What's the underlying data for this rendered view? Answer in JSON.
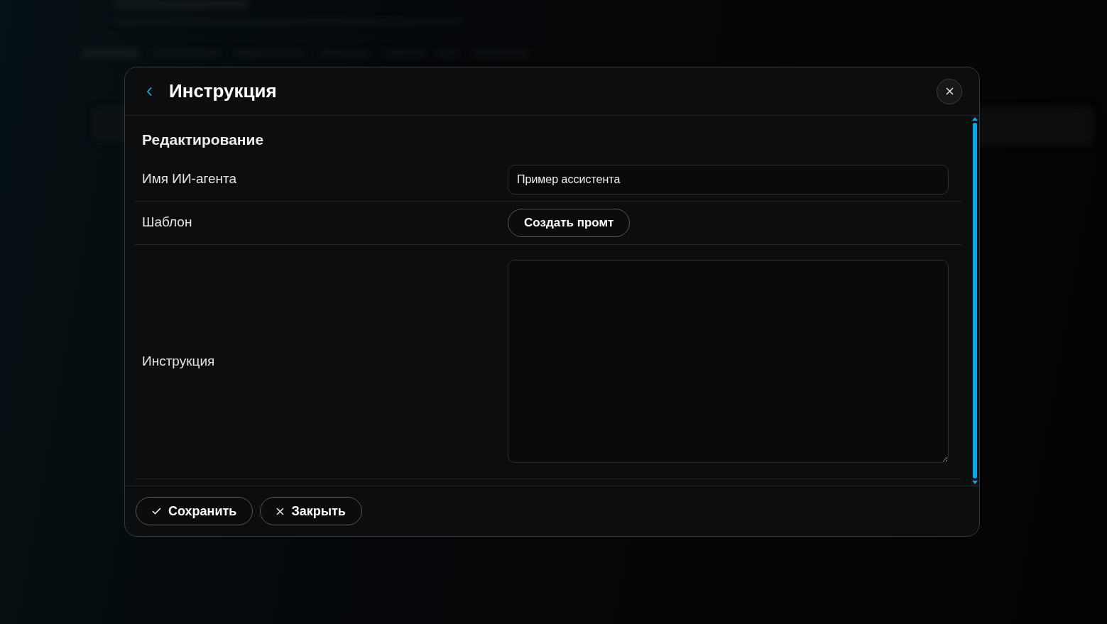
{
  "dialog": {
    "title": "Инструкция",
    "section_title": "Редактирование",
    "fields": [
      {
        "kind": "input",
        "label": "Имя ИИ-агента",
        "value": "Пример ассистента"
      },
      {
        "kind": "button",
        "label": "Шаблон",
        "button": "Создать промт"
      },
      {
        "kind": "textarea",
        "label": "Инструкция"
      }
    ],
    "footer_buttons": [
      {
        "kind": "check",
        "label": "Сохранить"
      },
      {
        "kind": "close",
        "label": "Закрыть"
      }
    ]
  }
}
